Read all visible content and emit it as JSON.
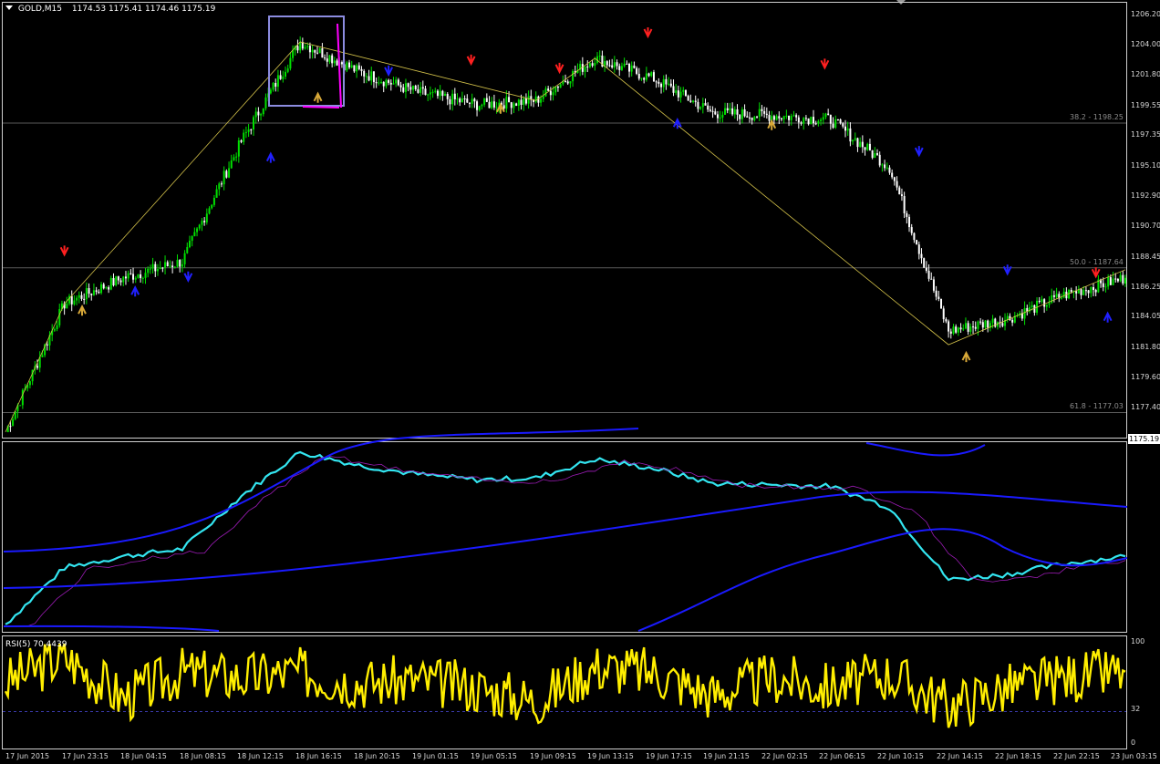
{
  "header": {
    "symbol": "GOLD,M15",
    "open": "1174.53",
    "high": "1175.41",
    "low": "1174.46",
    "close": "1175.19"
  },
  "price_axis": [
    "1206.20",
    "1204.00",
    "1201.80",
    "1199.55",
    "1197.35",
    "1195.10",
    "1192.90",
    "1190.70",
    "1188.45",
    "1186.25",
    "1184.05",
    "1181.80",
    "1179.60",
    "1177.40"
  ],
  "current_price": "1175.19",
  "fib_levels": [
    {
      "label": "38.2 - 1198.25",
      "price": 1198.25
    },
    {
      "label": "50.0 - 1187.64",
      "price": 1187.64
    },
    {
      "label": "61.8 - 1177.03",
      "price": 1177.03
    }
  ],
  "rsi": {
    "label": "RSI(5) 70.4439",
    "levels": [
      "100",
      "32",
      "0"
    ]
  },
  "time_axis": [
    "17 Jun 2015",
    "17 Jun 23:15",
    "18 Jun 04:15",
    "18 Jun 08:15",
    "18 Jun 12:15",
    "18 Jun 16:15",
    "18 Jun 20:15",
    "19 Jun 01:15",
    "19 Jun 05:15",
    "19 Jun 09:15",
    "19 Jun 13:15",
    "19 Jun 17:15",
    "19 Jun 21:15",
    "22 Jun 02:15",
    "22 Jun 06:15",
    "22 Jun 10:15",
    "22 Jun 14:15",
    "22 Jun 18:15",
    "22 Jun 22:15",
    "23 Jun 03:15"
  ],
  "colors": {
    "bull": "#00e000",
    "bear": "#ffffff",
    "close_line": "#33e5f0",
    "band": "#1a1aff",
    "purple": "#9b1bb5",
    "rsi": "#ffee00",
    "zigzag": "#d4c24a",
    "arrow_up": "#d8a838",
    "arrow_down_red": "#ff2020",
    "arrow_blue": "#2020ff",
    "box": "#8c8ce0",
    "magenta": "#ff00ff"
  },
  "chart_data": {
    "type": "line",
    "title": "GOLD,M15",
    "xlabel": "",
    "ylabel": "",
    "ylim": [
      1175.19,
      1206.2
    ],
    "x": [
      "17 Jun 2015",
      "17 Jun 23:15",
      "18 Jun 04:15",
      "18 Jun 08:15",
      "18 Jun 12:15",
      "18 Jun 16:15",
      "18 Jun 20:15",
      "19 Jun 01:15",
      "19 Jun 05:15",
      "19 Jun 09:15",
      "19 Jun 13:15",
      "19 Jun 17:15",
      "19 Jun 21:15",
      "22 Jun 02:15",
      "22 Jun 06:15",
      "22 Jun 10:15",
      "22 Jun 14:15",
      "22 Jun 18:15",
      "22 Jun 22:15",
      "23 Jun 03:15"
    ],
    "series": [
      {
        "values": [
          1175.6,
          1185.0,
          1186.9,
          1188.1,
          1196.9,
          1204.2,
          1202.0,
          1200.5,
          1199.6,
          1199.9,
          1203.0,
          1201.5,
          1199.0,
          1198.8,
          1198.5,
          1195.0,
          1183.0,
          1183.9,
          1185.7,
          1186.9
        ]
      }
    ],
    "rsi_series": [
      {
        "name": "RSI(5)",
        "values": [
          60,
          85,
          45,
          70,
          65,
          70,
          60,
          62,
          55,
          42,
          75,
          70,
          48,
          65,
          55,
          68,
          38,
          55,
          65,
          70.4439
        ]
      }
    ]
  }
}
